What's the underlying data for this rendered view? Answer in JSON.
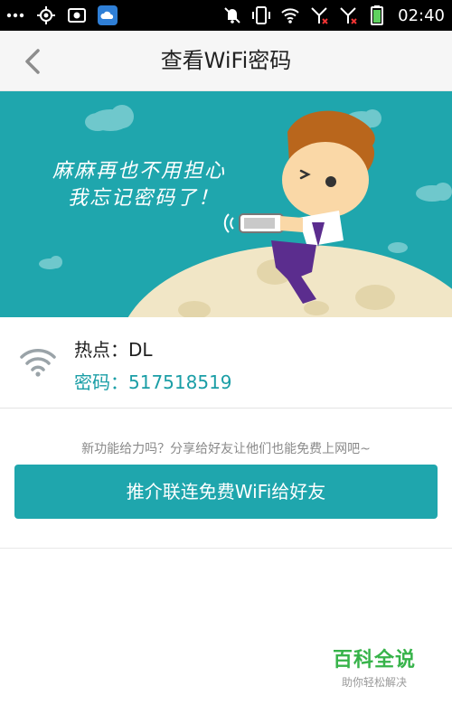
{
  "status_bar": {
    "time": "02:40",
    "left_icons": [
      "more-dots-icon",
      "gps-icon",
      "screenshot-icon",
      "cloud-app-icon"
    ],
    "right_icons": [
      "mute-icon",
      "vibrate-icon",
      "wifi-signal-icon",
      "sim1-no-signal-icon",
      "sim2-no-signal-icon",
      "battery-icon"
    ]
  },
  "header": {
    "title": "查看WiFi密码",
    "back_icon": "chevron-left-icon"
  },
  "banner": {
    "slogan_line1": "麻麻再也不用担心",
    "slogan_line2": "我忘记密码了！",
    "background_color": "#1fa6ad"
  },
  "hotspot": {
    "name_label": "热点：DL",
    "password_label": "密码：517518519",
    "wifi_icon": "wifi-icon",
    "accent_color": "#1a9ea6"
  },
  "share": {
    "hint": "新功能给力吗？分享给好友让他们也能免费上网吧~",
    "button_label": "推介联连免费WiFi给好友",
    "button_color": "#1fa6ad"
  },
  "watermark": {
    "title": "百科全说",
    "subtitle": "助你轻松解决"
  }
}
